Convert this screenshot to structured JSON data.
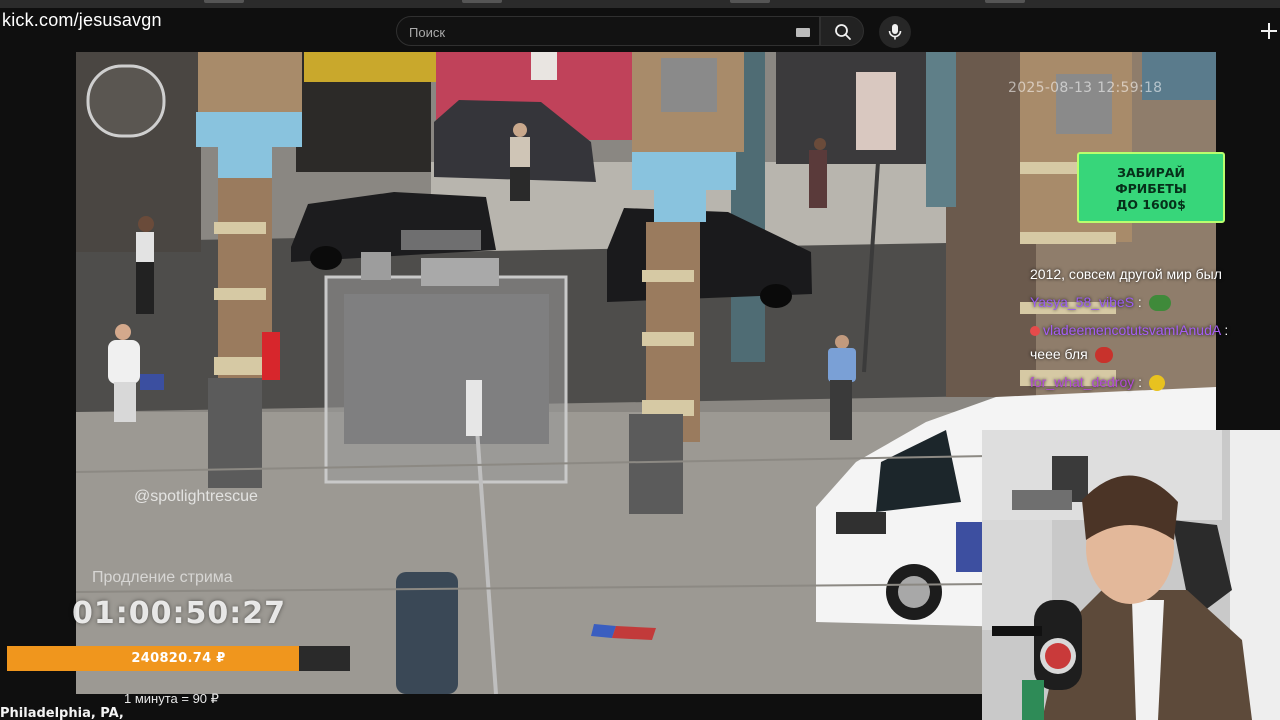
{
  "browser": {
    "url": "kick.com/jesusavgn"
  },
  "search": {
    "placeholder": "Поиск"
  },
  "icons": {
    "keyboard": "keyboard-icon",
    "search": "search-icon",
    "mic": "mic-icon",
    "create": "plus-icon"
  },
  "video": {
    "timestamp": "2025-08-13 12:59:18",
    "watermark": "@spotlightrescue"
  },
  "promo": {
    "line1": "ЗАБИРАЙ",
    "line2": "ФРИБЕТЫ",
    "line3": "ДО 1600$",
    "color": "#37d67a"
  },
  "chat": {
    "messages": [
      {
        "text": "2012, совсем другой мир был"
      },
      {
        "user": "Yasya_58_vibeS",
        "user_color": "#9b5cf2",
        "sep": " :"
      },
      {
        "user": "vladeemencotutsvamIAnudA",
        "user_color": "#a55df5",
        "sep": " :"
      },
      {
        "text": "чеее бля"
      },
      {
        "user": "for_what_dedroy",
        "user_color": "#b24ad6",
        "sep": " :"
      }
    ]
  },
  "stream": {
    "extension_label": "Продление стрима",
    "extension_timer": "01:00:50:27",
    "donation_total": "240820.74 ₽",
    "progress_fraction": 0.85,
    "rate": "1 минута = 90 ₽",
    "location": "Philadelphia, PA,"
  }
}
